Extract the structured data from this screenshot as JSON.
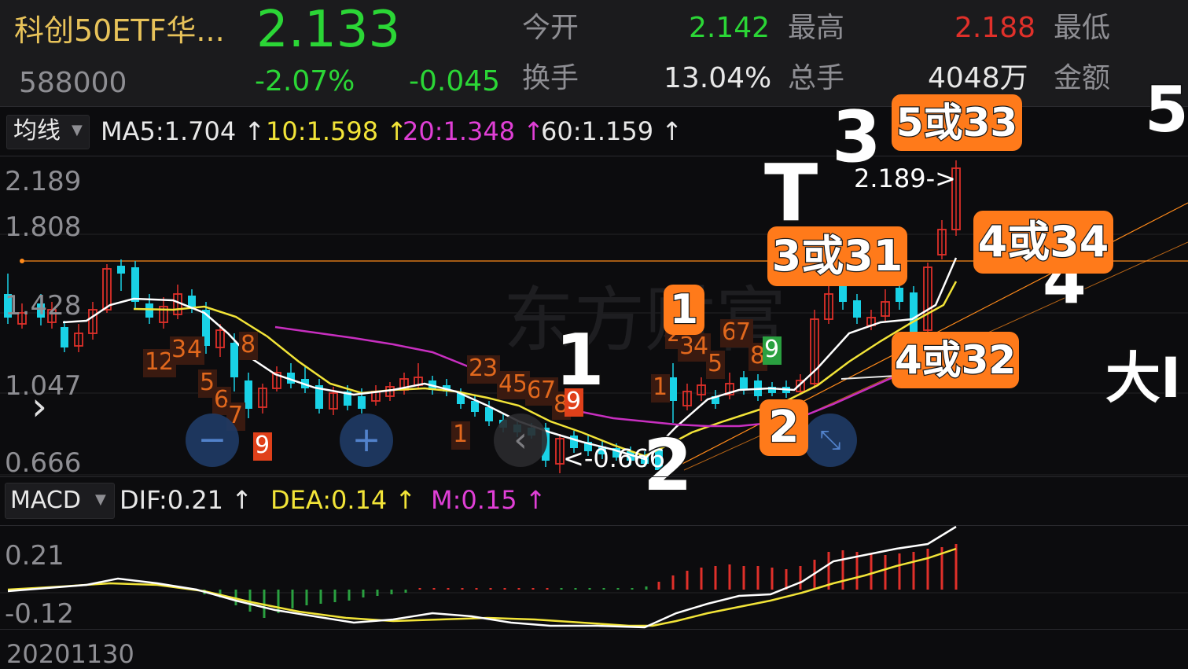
{
  "quote": {
    "name": "科创50ETF华...",
    "code": "588000",
    "price": "2.133",
    "change_pct": "-2.07%",
    "change_abs": "-0.045",
    "open_label": "今开",
    "open_value": "2.142",
    "high_label": "最高",
    "high_value": "2.188",
    "low_label": "最低",
    "turnover_label": "换手",
    "turnover_value": "13.04%",
    "volume_label": "总手",
    "volume_value": "4048万",
    "amount_label": "金额"
  },
  "ma_bar": {
    "selector": "均线",
    "ma5": "MA5:1.704",
    "ma10": "10:1.598",
    "ma20": "20:1.348",
    "ma60": "60:1.159",
    "arrow": "↑"
  },
  "price_axis": [
    "2.189",
    "1.808",
    "1.428",
    "1.047",
    "0.666"
  ],
  "price_marks": {
    "high": "2.189->",
    "low": "<-0.666"
  },
  "macd_bar": {
    "selector": "MACD",
    "dif": "DIF:0.21",
    "dea": "DEA:0.14",
    "m": "M:0.15",
    "arrow": "↑"
  },
  "macd_axis": [
    "0.21",
    "-0.12"
  ],
  "date_label": "20201130",
  "watermark": "东方财富",
  "annotations": {
    "wave1": "1",
    "wave2": "2",
    "wave3": "3",
    "wave4": "4",
    "wave5": "5",
    "tbar": "T",
    "box_5_33": "5或33",
    "box_3_31": "3或31",
    "box_4_34": "4或34",
    "box_4_32": "4或32",
    "box_1": "1",
    "box_2": "2",
    "big": "大I"
  },
  "counts": {
    "seq1": [
      "1",
      "2",
      "3",
      "4",
      "5",
      "6",
      "7",
      "8",
      "9"
    ],
    "seq2": [
      "1",
      "2",
      "3",
      "4",
      "5",
      "6",
      "7",
      "8",
      "9"
    ],
    "seq3": [
      "1",
      "2",
      "3",
      "4",
      "5",
      "6",
      "7",
      "8",
      "9"
    ]
  },
  "colors": {
    "up": "#e0302a",
    "down": "#19d2e6",
    "ma5": "#ffffff",
    "ma10": "#f2e438",
    "ma20": "#c82fc0",
    "ma60": "#ffffff",
    "accent": "#ff7a1a"
  },
  "controls": {
    "zoom_out": "−",
    "zoom_in": "+",
    "prev": "‹",
    "next": "›",
    "collapse": "⤡",
    "expand": "›"
  }
}
